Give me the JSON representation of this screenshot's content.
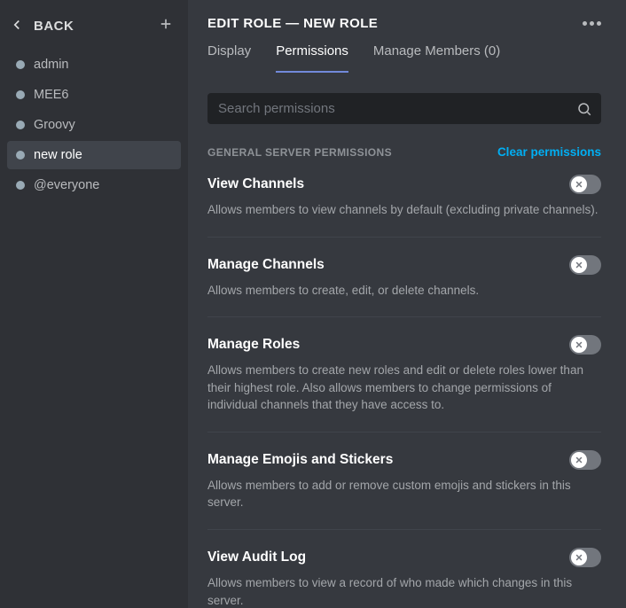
{
  "sidebar": {
    "back_label": "BACK",
    "roles": [
      {
        "name": "admin",
        "selected": false
      },
      {
        "name": "MEE6",
        "selected": false
      },
      {
        "name": "Groovy",
        "selected": false
      },
      {
        "name": "new role",
        "selected": true
      },
      {
        "name": "@everyone",
        "selected": false
      }
    ]
  },
  "header": {
    "title": "EDIT ROLE — NEW ROLE"
  },
  "tabs": [
    {
      "label": "Display",
      "active": false
    },
    {
      "label": "Permissions",
      "active": true
    },
    {
      "label": "Manage Members (0)",
      "active": false
    }
  ],
  "search": {
    "placeholder": "Search permissions",
    "value": ""
  },
  "section": {
    "label": "GENERAL SERVER PERMISSIONS",
    "clear_label": "Clear permissions"
  },
  "permissions": [
    {
      "name": "View Channels",
      "description": "Allows members to view channels by default (excluding private channels).",
      "enabled": false
    },
    {
      "name": "Manage Channels",
      "description": "Allows members to create, edit, or delete channels.",
      "enabled": false
    },
    {
      "name": "Manage Roles",
      "description": "Allows members to create new roles and edit or delete roles lower than their highest role. Also allows members to change permissions of individual channels that they have access to.",
      "enabled": false
    },
    {
      "name": "Manage Emojis and Stickers",
      "description": "Allows members to add or remove custom emojis and stickers in this server.",
      "enabled": false
    },
    {
      "name": "View Audit Log",
      "description": "Allows members to view a record of who made which changes in this server.",
      "enabled": false
    }
  ]
}
